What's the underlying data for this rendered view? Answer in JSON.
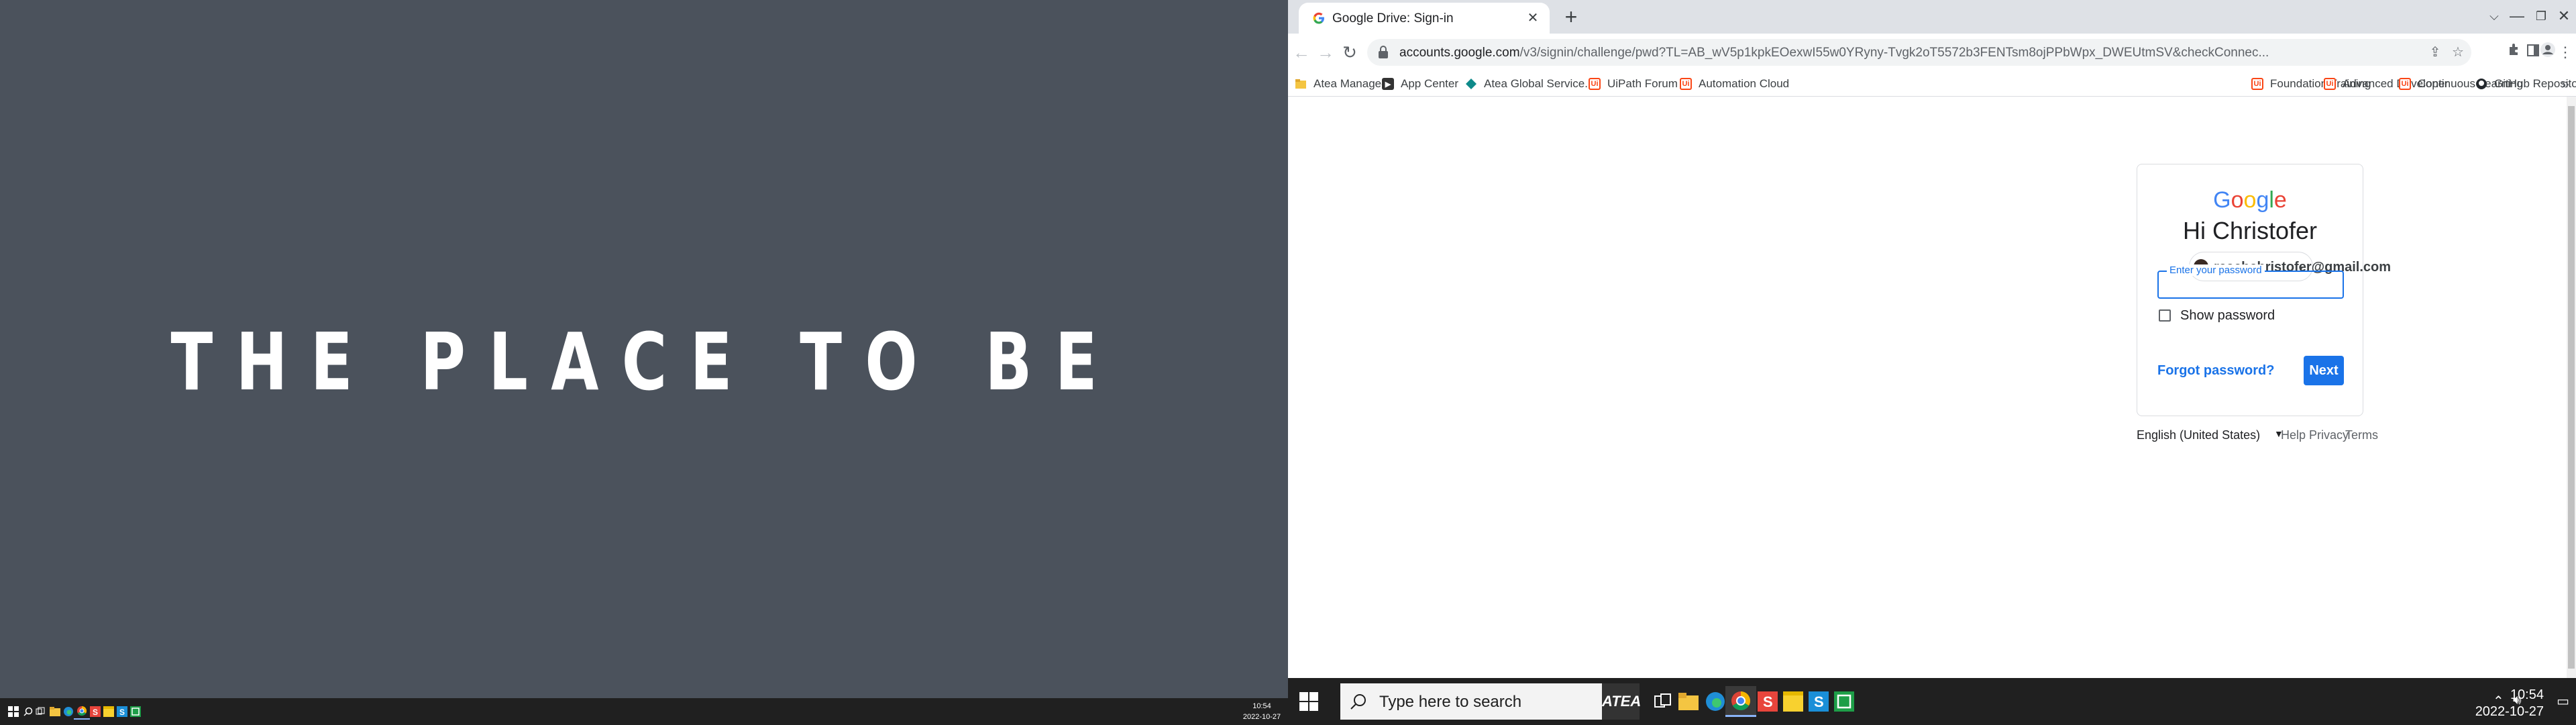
{
  "left": {
    "wallpaper_text": "THE PLACE TO BE",
    "clock_time": "10:54",
    "clock_date": "2022-10-27"
  },
  "browser": {
    "tab_title": "Google Drive: Sign-in",
    "url_host": "accounts.google.com",
    "url_path": "/v3/signin/challenge/pwd?TL=AB_wV5p1kpkEOexwI55w0YRyny-Tvgk2oT5572b3FENTsm8ojPPbWpx_DWEUtmSV&checkConnec...",
    "bookmarks": [
      {
        "label": "Atea Managed",
        "icon": "folder-icon"
      },
      {
        "label": "App Center",
        "icon": "app-center-icon"
      },
      {
        "label": "Atea Global Service...",
        "icon": "atea-global-icon"
      },
      {
        "label": "UiPath Forum",
        "icon": "uipath-icon"
      },
      {
        "label": "Automation Cloud",
        "icon": "uipath-icon"
      },
      {
        "label": "Foundation Training",
        "icon": "uipath-icon"
      },
      {
        "label": "Advanced Developer",
        "icon": "uipath-icon"
      },
      {
        "label": "Continuous Learning",
        "icon": "uipath-icon"
      },
      {
        "label": "GitHub Repositories",
        "icon": "github-icon"
      }
    ],
    "bookmarks_more": "»"
  },
  "signin": {
    "logo": [
      "G",
      "o",
      "o",
      "g",
      "l",
      "e"
    ],
    "logo_colors": [
      "#4285F4",
      "#EA4335",
      "#FBBC05",
      "#4285F4",
      "#34A853",
      "#EA4335"
    ],
    "greeting": "Hi Christofer",
    "email": "reachchristofer@gmail.com",
    "password_label": "Enter your password",
    "show_password": "Show password",
    "forgot": "Forgot password?",
    "next": "Next"
  },
  "footer": {
    "language": "English (United States)",
    "help": "Help",
    "privacy": "Privacy",
    "terms": "Terms"
  },
  "taskbar": {
    "search_placeholder": "Type here to search",
    "atea_label": "ATEA",
    "clock_time": "10:54",
    "clock_date": "2022-10-27"
  },
  "colors": {
    "accent": "#1a73e8",
    "wallpaper": "#4b525c",
    "taskbar": "#202020"
  }
}
